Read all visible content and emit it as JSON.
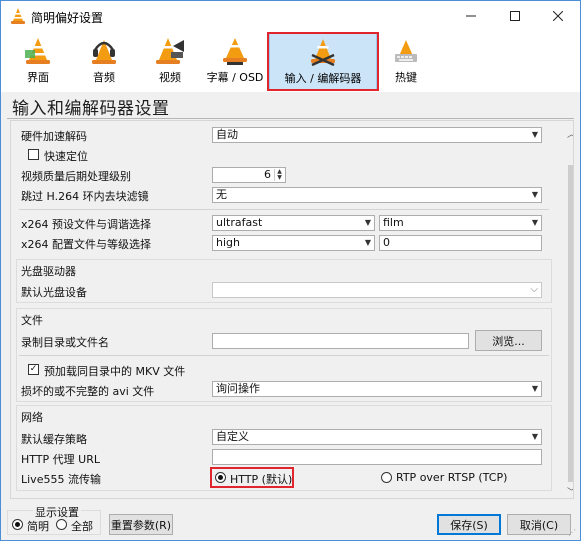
{
  "window": {
    "title": "简明偏好设置"
  },
  "toolbar": {
    "tabs": [
      {
        "label": "界面"
      },
      {
        "label": "音频"
      },
      {
        "label": "视频"
      },
      {
        "label": "字幕 / OSD"
      },
      {
        "label": "输入 / 编解码器"
      },
      {
        "label": "热键"
      }
    ]
  },
  "page": {
    "title": "输入和编解码器设置"
  },
  "codecs": {
    "hw_decoding_label": "硬件加速解码",
    "hw_decoding_value": "自动",
    "fast_seek_label": "快速定位",
    "pp_level_label": "视频质量后期处理级别",
    "pp_level_value": "6",
    "skip_loop_label": "跳过 H.264 环内去块滤镜",
    "skip_loop_value": "无",
    "x264_preset_label": "x264 预设文件与调谐选择",
    "x264_preset_value": "ultrafast",
    "x264_tune_value": "film",
    "x264_profile_label": "x264 配置文件与等级选择",
    "x264_profile_value": "high",
    "x264_level_value": "0"
  },
  "optical": {
    "group_title": "光盘驱动器",
    "device_label": "默认光盘设备",
    "device_value": ""
  },
  "files": {
    "group_title": "文件",
    "record_label": "录制目录或文件名",
    "record_value": "",
    "browse_label": "浏览...",
    "preload_mkv_label": "预加载同目录中的 MKV 文件",
    "broken_avi_label": "损坏的或不完整的 avi 文件",
    "broken_avi_value": "询问操作"
  },
  "network": {
    "group_title": "网络",
    "cache_label": "默认缓存策略",
    "cache_value": "自定义",
    "proxy_label": "HTTP 代理 URL",
    "proxy_value": "",
    "live555_label": "Live555 流传输",
    "http_label": "HTTP (默认)",
    "rtsp_label": "RTP over RTSP (TCP)"
  },
  "display": {
    "group_title": "显示设置",
    "simple_label": "简明",
    "all_label": "全部"
  },
  "buttons": {
    "reset_label": "重置参数(R)",
    "save_label": "保存(S)",
    "cancel_label": "取消(C)"
  },
  "colors": {
    "accent": "#0078d7",
    "highlight": "#e0262c",
    "tab_active": "#cce4f7",
    "vlc_orange": "#f39c12"
  }
}
